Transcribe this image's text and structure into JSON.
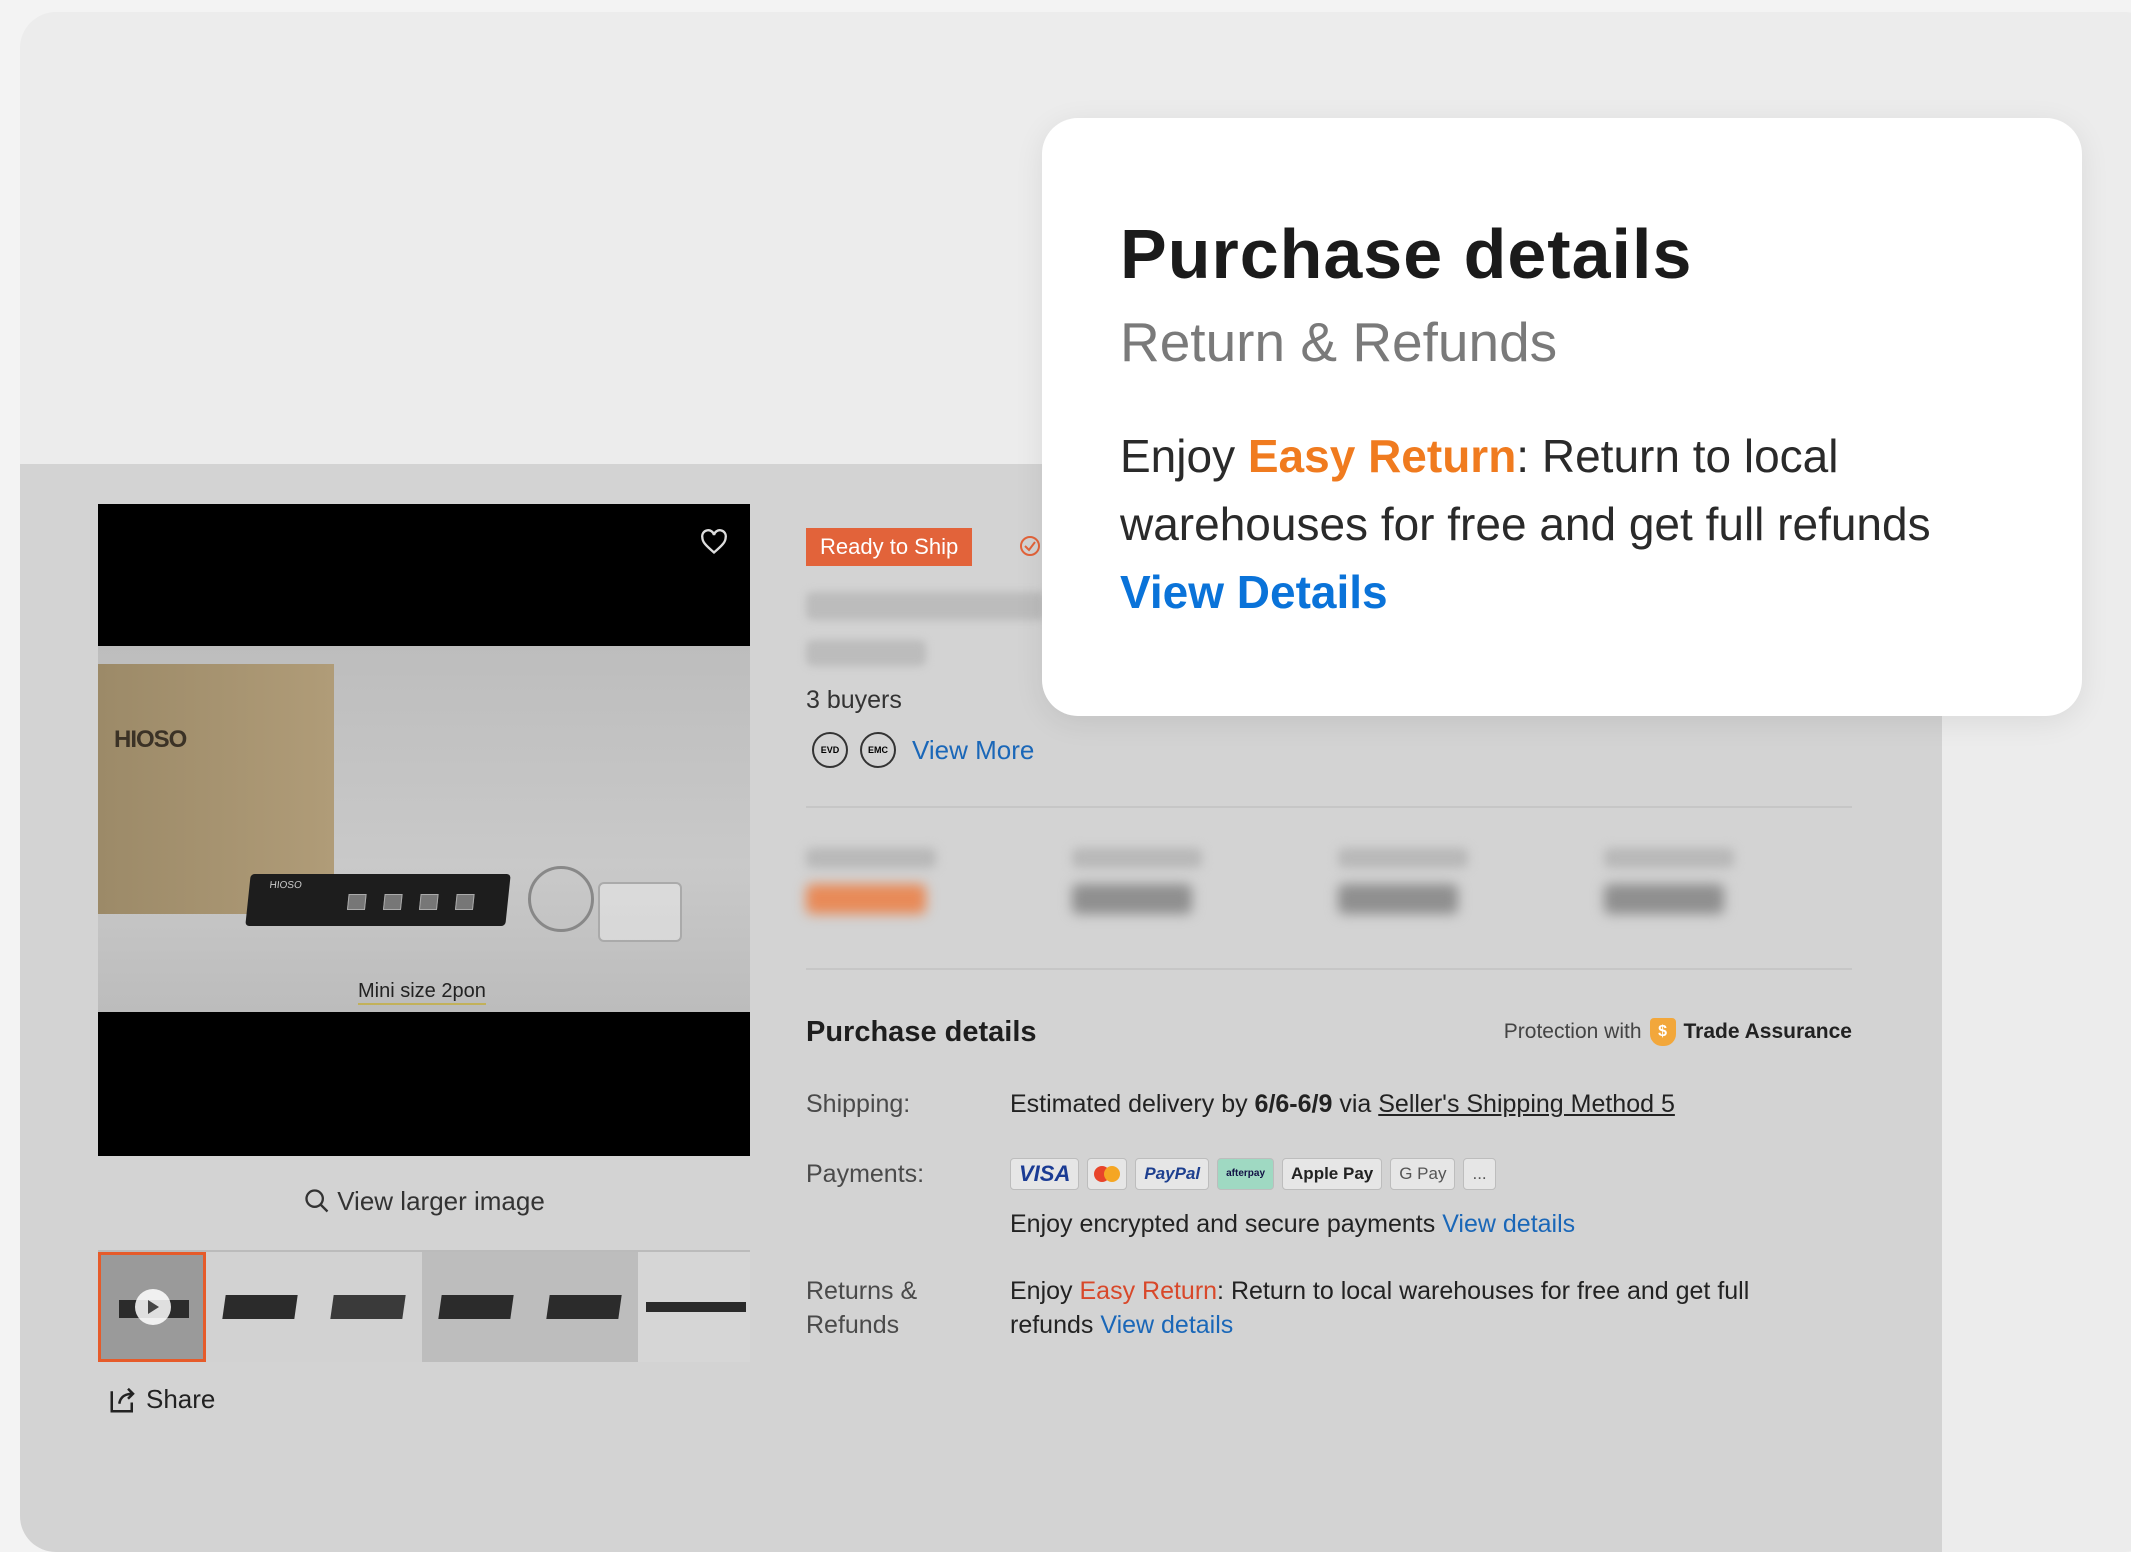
{
  "media": {
    "box_brand": "HIOSO",
    "device_brand": "HIOSO",
    "video_caption": "Mini size 2pon",
    "view_larger_label": "View larger image",
    "share_label": "Share"
  },
  "product": {
    "badge": "Ready to Ship",
    "buyers": "3 buyers",
    "certifications": [
      "EVD",
      "EMC"
    ],
    "view_more": "View More"
  },
  "purchase_details": {
    "title": "Purchase details",
    "protection_prefix": "Protection with",
    "trade_assurance": "Trade Assurance",
    "shipping": {
      "label": "Shipping:",
      "prefix": "Estimated delivery by ",
      "dates": "6/6-6/9",
      "via": " via ",
      "method": "Seller's Shipping Method 5"
    },
    "payments": {
      "label": "Payments:",
      "methods": [
        "VISA",
        "Mastercard",
        "PayPal",
        "afterpay",
        "Apple Pay",
        "G Pay",
        "..."
      ],
      "note": "Enjoy encrypted and secure payments ",
      "link": "View details"
    },
    "returns": {
      "label_line1": "Returns &",
      "label_line2": "Refunds",
      "prefix": "Enjoy ",
      "highlight": "Easy Return",
      "text_line1": ": Return to local warehouses for free and get full",
      "text_line2": "refunds ",
      "link": "View details"
    }
  },
  "popup": {
    "title": "Purchase details",
    "subtitle": "Return & Refunds",
    "prefix": "Enjoy ",
    "highlight": "Easy Return",
    "text": ": Return to local warehouses for free and get full refunds",
    "link": "View Details"
  },
  "colors": {
    "accent_orange": "#f07b1f",
    "link_blue": "#0a73d9",
    "badge_red": "#e2633a"
  }
}
